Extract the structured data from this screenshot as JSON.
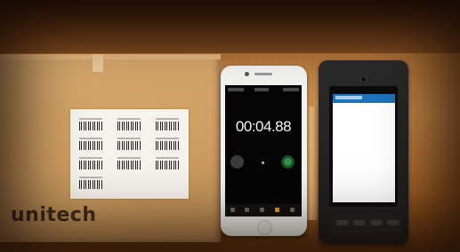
{
  "box": {
    "brand": "unitech"
  },
  "iphone": {
    "stopwatch_time": "00:04.88"
  },
  "colors": {
    "table_wood": "#b4743a",
    "cardboard": "#cf9f63",
    "stopwatch_start_green": "#34c759",
    "unitech_appbar_blue": "#1e73b9"
  },
  "icons": {
    "lap": "lap-button-icon",
    "start": "start-button-icon"
  }
}
